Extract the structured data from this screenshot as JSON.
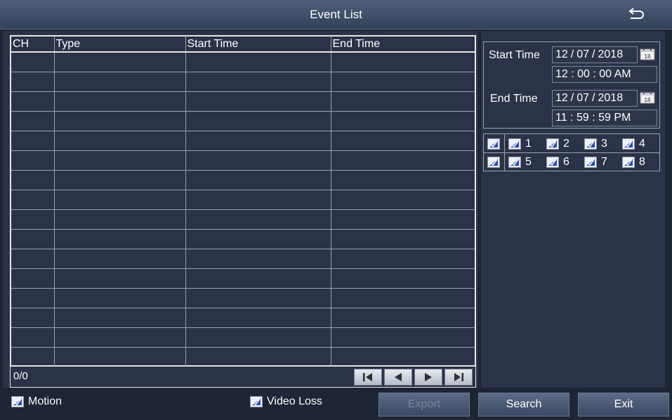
{
  "window": {
    "title": "Event List"
  },
  "table": {
    "columns": [
      "CH",
      "Type",
      "Start Time",
      "End Time"
    ],
    "row_count": 16,
    "page_count": "0/0"
  },
  "start_time": {
    "label": "Start Time",
    "month": "12",
    "day": "07",
    "year": "2018",
    "time": "12 : 00 : 00 AM"
  },
  "end_time": {
    "label": "End Time",
    "month": "12",
    "day": "07",
    "year": "2018",
    "time": "11 : 59 : 59 PM"
  },
  "date_separator": "/",
  "calendar_icon_text": "18",
  "channels": {
    "row1": [
      "1",
      "2",
      "3",
      "4"
    ],
    "row2": [
      "5",
      "6",
      "7",
      "8"
    ]
  },
  "options": {
    "motion": "Motion",
    "video_loss": "Video Loss"
  },
  "buttons": {
    "export": "Export",
    "search": "Search",
    "exit": "Exit"
  },
  "colors": {
    "background": "#1e2535",
    "panel": "#2a3347",
    "checkbox_check": "#2a4fb0"
  }
}
